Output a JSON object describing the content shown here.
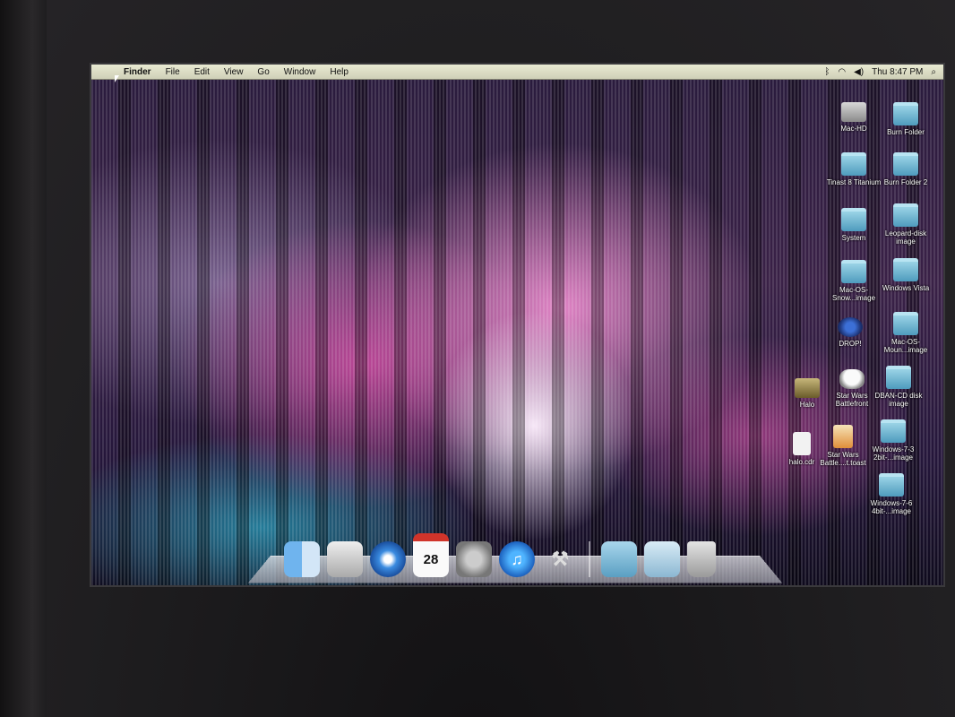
{
  "menubar": {
    "apple_glyph": "",
    "items": [
      "Finder",
      "File",
      "Edit",
      "View",
      "Go",
      "Window",
      "Help"
    ],
    "clock": "Thu 8:47 PM",
    "status_icons": [
      "bluetooth-icon",
      "wifi-icon",
      "volume-icon",
      "spotlight-icon"
    ]
  },
  "desktop_icons": [
    {
      "label": "Mac-HD",
      "kind": "hd"
    },
    {
      "label": "Burn Folder",
      "kind": "folder"
    },
    {
      "label": "Tinast 8 Titanium",
      "kind": "folder"
    },
    {
      "label": "Burn Folder 2",
      "kind": "folder"
    },
    {
      "label": "System",
      "kind": "folder"
    },
    {
      "label": "Leopard-disk image",
      "kind": "folder"
    },
    {
      "label": "Mac-OS-Snow...image",
      "kind": "folder"
    },
    {
      "label": "Windows Vista",
      "kind": "folder"
    },
    {
      "label": "DROP!",
      "kind": "drop"
    },
    {
      "label": "Mac-OS-Moun...image",
      "kind": "folder"
    },
    {
      "label": "Halo",
      "kind": "halo"
    },
    {
      "label": "Star Wars Battlefront",
      "kind": "trooper"
    },
    {
      "label": "DBAN-CD disk image",
      "kind": "folder"
    },
    {
      "label": "halo.cdr",
      "kind": "doc"
    },
    {
      "label": "Star Wars Battle....t.toast",
      "kind": "toast"
    },
    {
      "label": "Windows-7-3 2bit-...image",
      "kind": "folder"
    },
    {
      "label": "Windows-7-6 4bit-...image",
      "kind": "folder"
    }
  ],
  "dock": {
    "ical_day": "28",
    "itunes_glyph": "♫",
    "utility_glyph": "⚒",
    "apps": [
      "finder-icon",
      "preview-icon",
      "safari-icon",
      "ical-icon",
      "system-preferences-icon",
      "itunes-icon",
      "utilities-icon",
      "applications-folder-icon",
      "documents-stack-icon",
      "trash-icon"
    ]
  }
}
